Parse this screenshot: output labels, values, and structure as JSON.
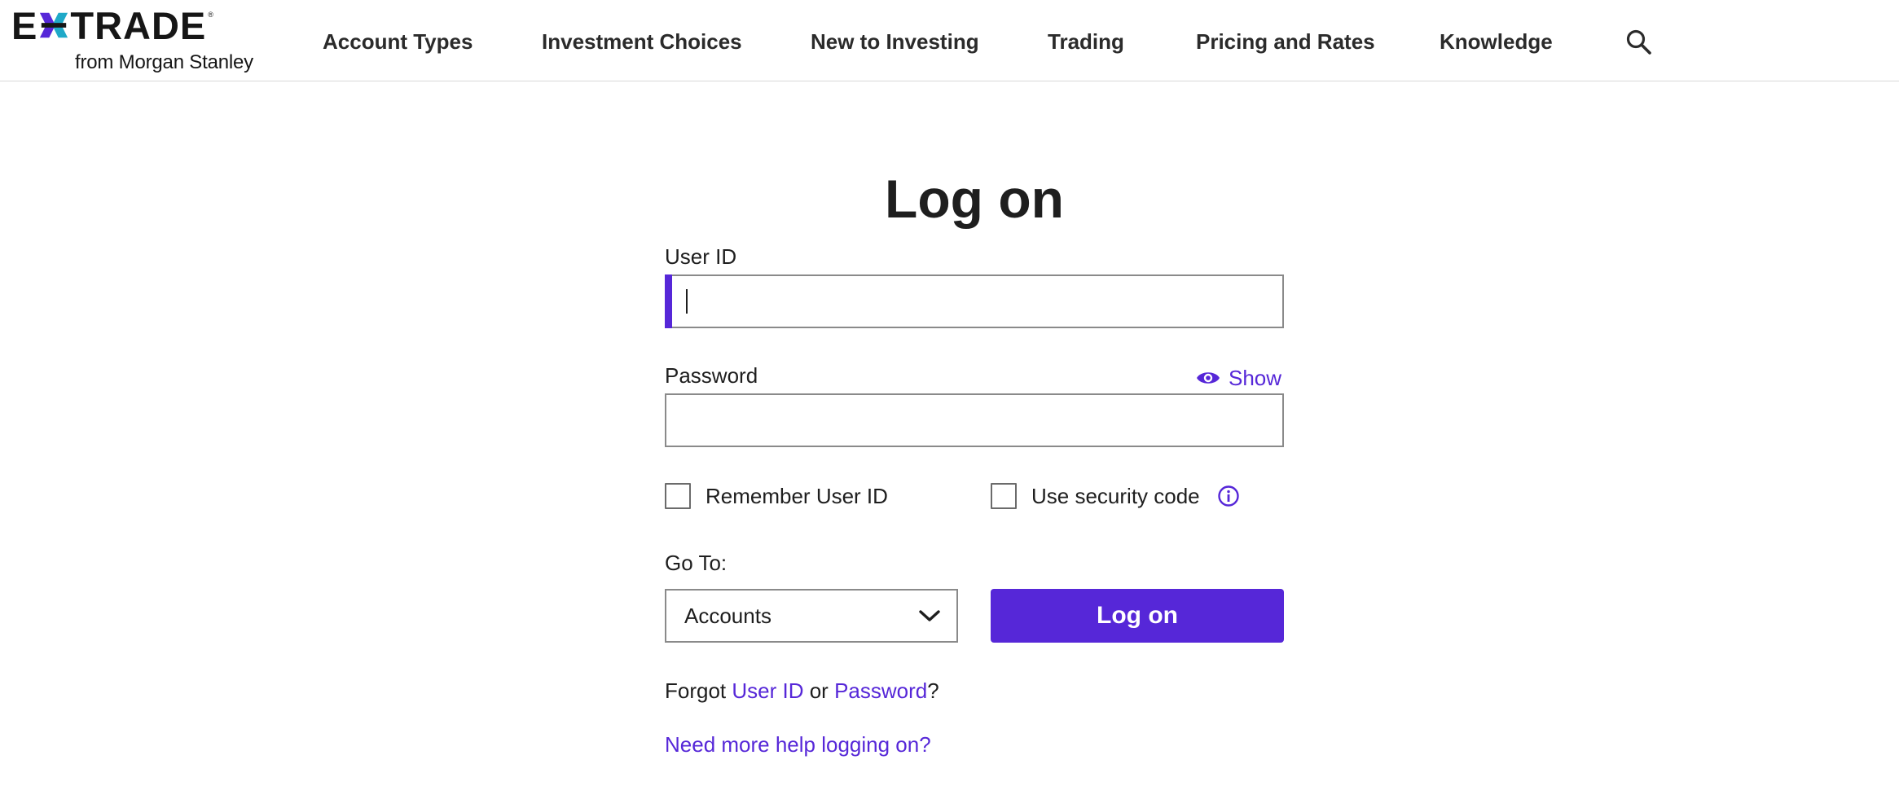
{
  "brand": {
    "name_left": "E",
    "name_right": "TRADE",
    "registered": "®",
    "subtitle": "from Morgan Stanley",
    "accent_purple": "#5627d8",
    "accent_teal": "#1fa9c8",
    "x_icon": "etrade-x-mark"
  },
  "nav": {
    "items": [
      {
        "label": "Account Types"
      },
      {
        "label": "Investment Choices"
      },
      {
        "label": "New to Investing"
      },
      {
        "label": "Trading"
      },
      {
        "label": "Pricing and Rates"
      },
      {
        "label": "Knowledge"
      }
    ],
    "search_icon": "search-icon"
  },
  "login": {
    "title": "Log on",
    "user_id_label": "User ID",
    "user_id_value": "",
    "password_label": "Password",
    "password_value": "",
    "show_label": "Show",
    "show_icon": "eye-icon",
    "remember_label": "Remember User ID",
    "remember_checked": false,
    "security_code_label": "Use security code",
    "security_code_checked": false,
    "info_icon": "info-icon",
    "goto_label": "Go To:",
    "goto_selected": "Accounts",
    "submit_label": "Log on",
    "forgot_prefix": "Forgot ",
    "forgot_user_id": "User ID",
    "forgot_or": " or ",
    "forgot_password": "Password",
    "forgot_suffix": "?",
    "help_link": "Need more help logging on?"
  }
}
